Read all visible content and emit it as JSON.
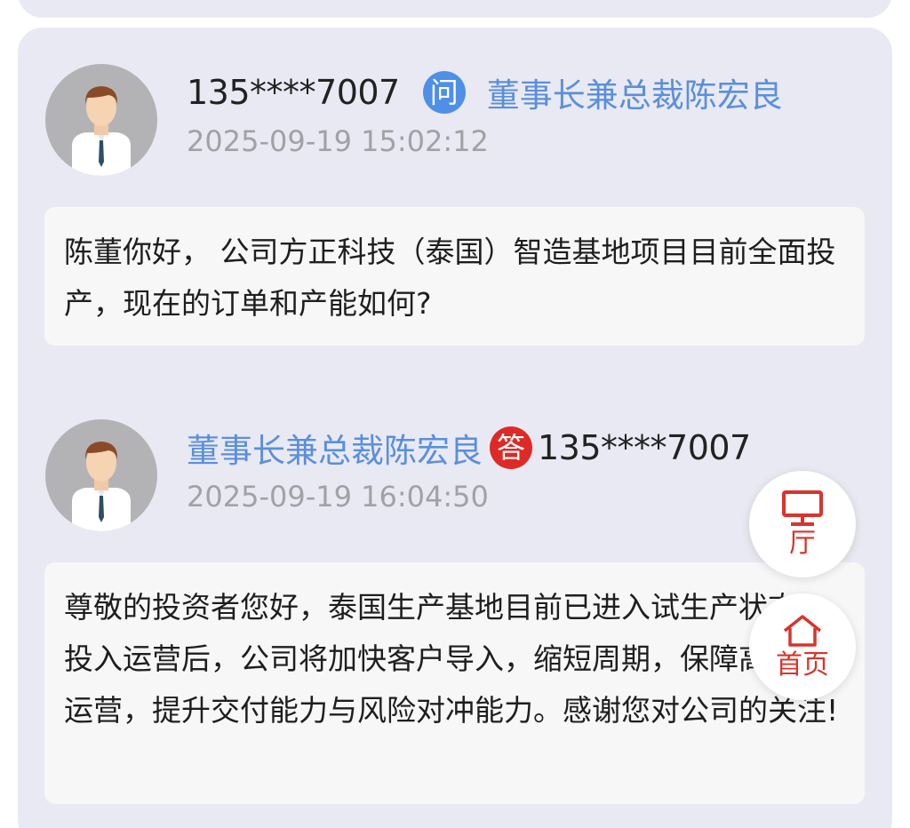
{
  "question": {
    "user_phone": "135****7007",
    "badge": "问",
    "target_name": "董事长兼总裁陈宏良",
    "timestamp": "2025-09-19 15:02:12",
    "content": "陈董你好， 公司方正科技（泰国）智造基地项目目前全面投产，现在的订单和产能如何?"
  },
  "answer": {
    "responder_name": "董事长兼总裁陈宏良",
    "badge": "答",
    "reply_to_phone": "135****7007",
    "timestamp": "2025-09-19 16:04:50",
    "content": "尊敬的投资者您好，泰国生产基地目前已进入试生产状态，投入运营后，公司将加快客户导入，缩短周期，保障高质量运营，提升交付能力与风险对冲能力。感谢您对公司的关注!"
  },
  "floating_buttons": {
    "hall_label": "厅",
    "hall_icon": "monitor-icon",
    "home_label": "首页",
    "home_icon": "home-icon",
    "accent_color": "#d9342b"
  },
  "colors": {
    "card_bg": "#e9e9f3",
    "name_link": "#5a8fdc",
    "question_badge": "#4f8fe6",
    "answer_badge": "#dd2a27"
  }
}
